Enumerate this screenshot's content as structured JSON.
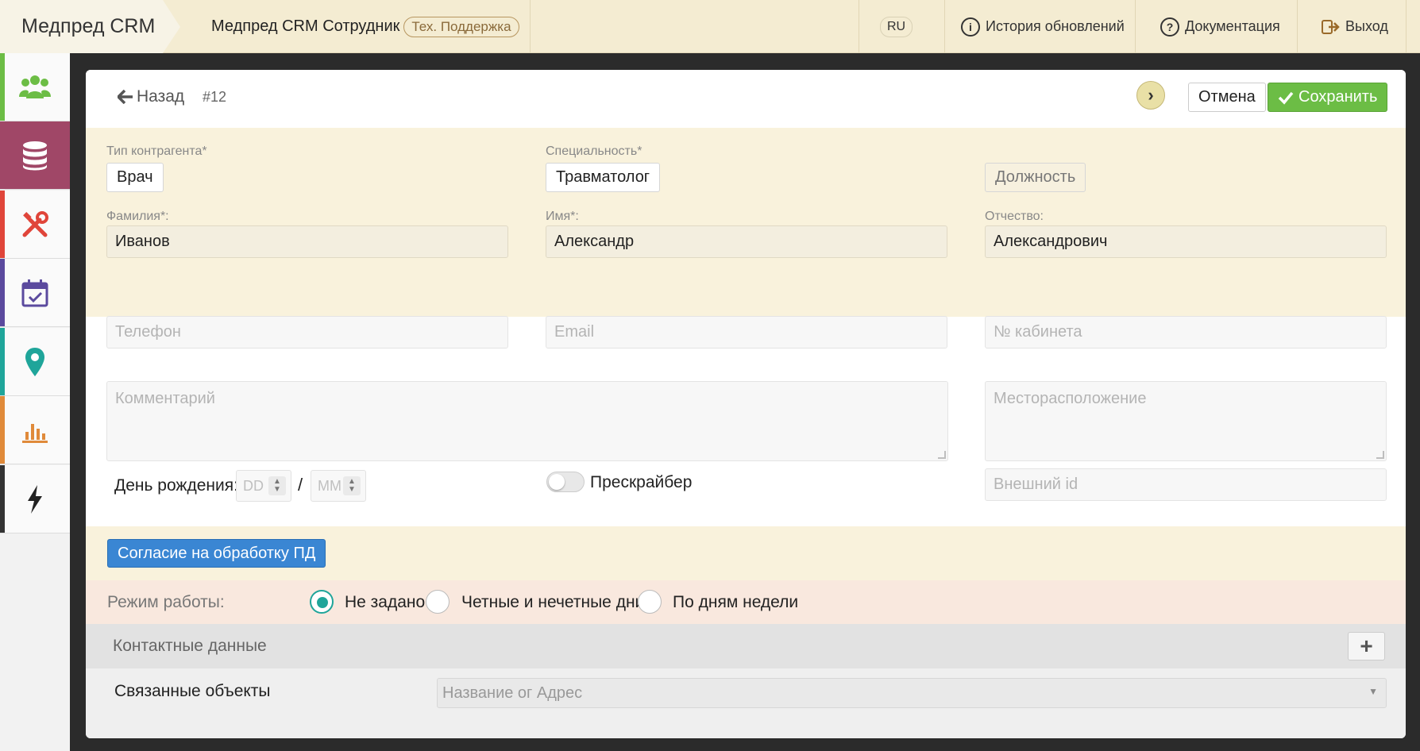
{
  "app": {
    "brand": "Медпред CRM",
    "title": "Медпред CRM Сотрудник",
    "role_badge": "Тех. Поддержка"
  },
  "topnav": {
    "lang": "RU",
    "history": "История обновлений",
    "docs": "Документация",
    "logout": "Выход"
  },
  "sidebar": {
    "items": [
      {
        "icon": "users-icon",
        "color": "#6cbd45"
      },
      {
        "icon": "database-icon",
        "color": "#a04767"
      },
      {
        "icon": "tools-icon",
        "color": "#e0453a"
      },
      {
        "icon": "calendar-check-icon",
        "color": "#5b4a9e"
      },
      {
        "icon": "map-pin-icon",
        "color": "#1fa59a"
      },
      {
        "icon": "bar-chart-icon",
        "color": "#e08a3a"
      },
      {
        "icon": "bolt-icon",
        "color": "#333333"
      }
    ]
  },
  "header": {
    "back": "Назад",
    "record_id": "#12",
    "cancel": "Отмена",
    "save": "Сохранить"
  },
  "form": {
    "type_label": "Тип контрагента*",
    "type_value": "Врач",
    "specialty_label": "Специальность*",
    "specialty_value": "Травматолог",
    "position_button": "Должность",
    "lastname_label": "Фамилия*:",
    "lastname_value": "Иванов",
    "firstname_label": "Имя*:",
    "firstname_value": "Александр",
    "patronymic_label": "Отчество:",
    "patronymic_value": "Александрович",
    "phone_placeholder": "Телефон",
    "email_placeholder": "Email",
    "office_placeholder": "№ кабинета",
    "comment_placeholder": "Комментарий",
    "location_placeholder": "Месторасположение",
    "birthday_label": "День рождения:",
    "day_placeholder": "DD",
    "month_placeholder": "MM",
    "birthday_separator": "/",
    "prescriber_label": "Прескрайбер",
    "external_id_placeholder": "Внешний id",
    "consent_button": "Согласие на обработку ПД"
  },
  "work_mode": {
    "label": "Режим работы:",
    "options": [
      "Не задано",
      "Четные и нечетные дни",
      "По дням недели"
    ],
    "selected": "Не задано"
  },
  "contacts": {
    "title": "Контактные данные",
    "add": "+"
  },
  "linked": {
    "label": "Связанные объекты",
    "placeholder": "Название ог Адрес"
  }
}
